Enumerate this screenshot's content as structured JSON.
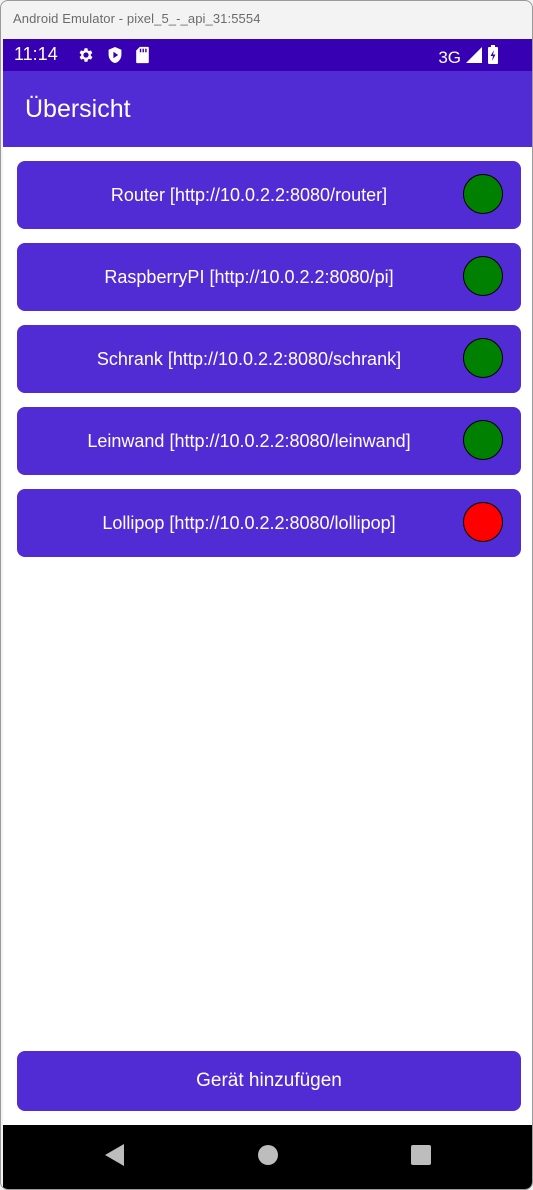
{
  "window": {
    "title": "Android Emulator - pixel_5_-_api_31:5554"
  },
  "status_bar": {
    "time": "11:14",
    "network": "3G",
    "icons": [
      "settings-icon",
      "shield-icon",
      "sd-card-icon",
      "signal-icon",
      "battery-icon"
    ],
    "background": "#3700b3"
  },
  "app_bar": {
    "title": "Übersicht",
    "background": "#512bd4"
  },
  "devices": [
    {
      "label": "Router [http://10.0.2.2:8080/router]",
      "status_color": "#008000"
    },
    {
      "label": "RaspberryPI [http://10.0.2.2:8080/pi]",
      "status_color": "#008000"
    },
    {
      "label": "Schrank [http://10.0.2.2:8080/schrank]",
      "status_color": "#008000"
    },
    {
      "label": "Leinwand [http://10.0.2.2:8080/leinwand]",
      "status_color": "#008000"
    },
    {
      "label": "Lollipop [http://10.0.2.2:8080/lollipop]",
      "status_color": "#ff0000"
    }
  ],
  "add_button": {
    "label": "Gerät hinzufügen"
  },
  "nav_bar": {
    "icons": [
      "back-icon",
      "home-icon",
      "recents-icon"
    ]
  },
  "colors": {
    "accent": "#512bd4",
    "status_ok": "#008000",
    "status_error": "#ff0000"
  }
}
